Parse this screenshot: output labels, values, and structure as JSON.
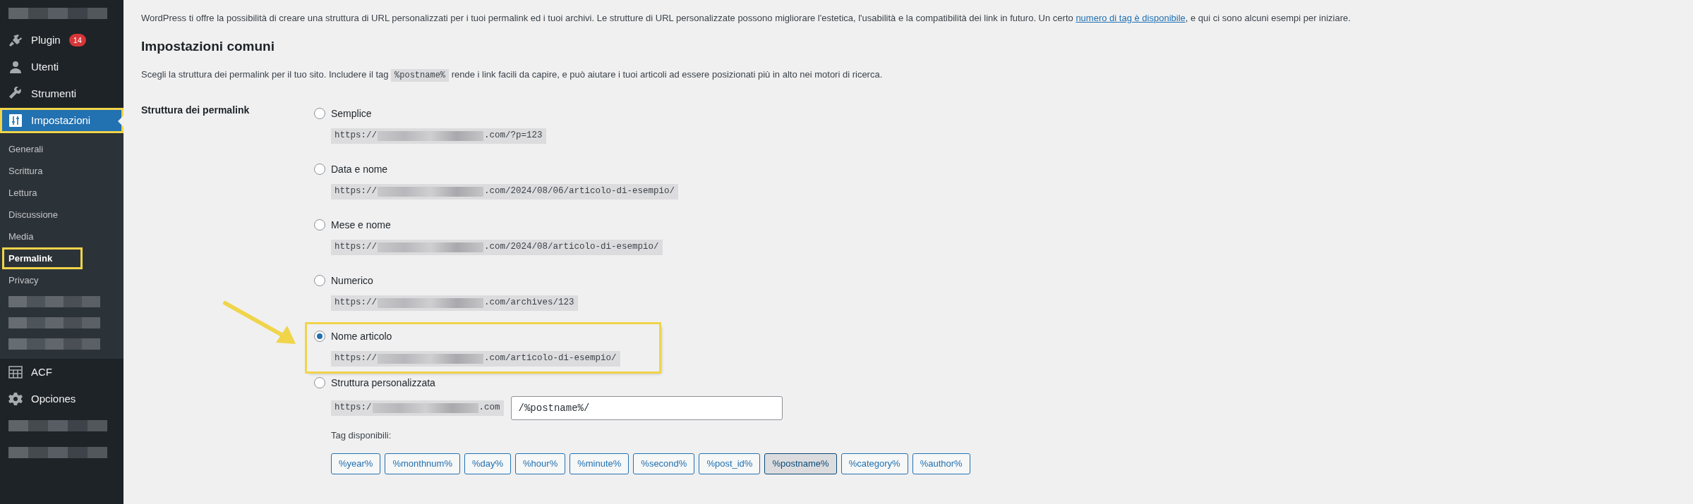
{
  "sidebar": {
    "items": [
      {
        "kind": "redacted"
      },
      {
        "kind": "item",
        "label": "Plugin",
        "badge": "14",
        "selected": false,
        "highlighted": false
      },
      {
        "kind": "item",
        "label": "Utenti",
        "selected": false,
        "highlighted": false
      },
      {
        "kind": "item",
        "label": "Strumenti",
        "selected": false,
        "highlighted": false
      },
      {
        "kind": "item",
        "label": "Impostazioni",
        "selected": true,
        "highlighted": true,
        "children": [
          {
            "kind": "item",
            "label": "Generali",
            "selected": false,
            "highlighted": false
          },
          {
            "kind": "item",
            "label": "Scrittura",
            "selected": false,
            "highlighted": false
          },
          {
            "kind": "item",
            "label": "Lettura",
            "selected": false,
            "highlighted": false
          },
          {
            "kind": "item",
            "label": "Discussione",
            "selected": false,
            "highlighted": false
          },
          {
            "kind": "item",
            "label": "Media",
            "selected": false,
            "highlighted": false
          },
          {
            "kind": "item",
            "label": "Permalink",
            "selected": true,
            "highlighted": true
          },
          {
            "kind": "item",
            "label": "Privacy",
            "selected": false,
            "highlighted": false
          },
          {
            "kind": "redacted"
          },
          {
            "kind": "redacted"
          },
          {
            "kind": "redacted"
          }
        ]
      },
      {
        "kind": "item",
        "label": "ACF",
        "selected": false,
        "highlighted": false
      },
      {
        "kind": "item",
        "label": "Opciones",
        "selected": false,
        "highlighted": false
      },
      {
        "kind": "redacted"
      },
      {
        "kind": "redacted"
      }
    ]
  },
  "intro": {
    "before": "WordPress ti offre la possibilità di creare una struttura di URL personalizzati per i tuoi permalink ed i tuoi archivi. Le strutture di URL personalizzate possono migliorare l'estetica, l'usabilità e la compatibilità dei link in futuro. Un certo",
    "link": "numero di tag è disponibile",
    "after": ", e qui ci sono alcuni esempi per iniziare."
  },
  "heading": "Impostazioni comuni",
  "description": {
    "before": "Scegli la struttura dei permalink per il tuo sito. Includere il tag",
    "code": "%postname%",
    "after": "rende i link facili da capire, e può aiutare i tuoi articoli ad essere posizionati più in alto nei motori di ricerca."
  },
  "structure_label": "Struttura dei permalink",
  "options": [
    {
      "label": "Semplice",
      "url_prefix": "https://",
      "url_suffix": ".com/?p=123",
      "selected": false,
      "highlighted": false
    },
    {
      "label": "Data e nome",
      "url_prefix": "https://",
      "url_suffix": ".com/2024/08/06/articolo-di-esempio/",
      "selected": false,
      "highlighted": false
    },
    {
      "label": "Mese e nome",
      "url_prefix": "https://",
      "url_suffix": ".com/2024/08/articolo-di-esempio/",
      "selected": false,
      "highlighted": false
    },
    {
      "label": "Numerico",
      "url_prefix": "https://",
      "url_suffix": ".com/archives/123",
      "selected": false,
      "highlighted": false
    },
    {
      "label": "Nome articolo",
      "url_prefix": "https://",
      "url_suffix": ".com/articolo-di-esempio/",
      "selected": true,
      "highlighted": true
    }
  ],
  "custom": {
    "label": "Struttura personalizzata",
    "selected": false,
    "url_prefix": "https:/",
    "url_suffix": ".com",
    "value": "/%postname%/",
    "tags_label": "Tag disponibili:",
    "tags": [
      {
        "label": "%year%",
        "selected": false
      },
      {
        "label": "%monthnum%",
        "selected": false
      },
      {
        "label": "%day%",
        "selected": false
      },
      {
        "label": "%hour%",
        "selected": false
      },
      {
        "label": "%minute%",
        "selected": false
      },
      {
        "label": "%second%",
        "selected": false
      },
      {
        "label": "%post_id%",
        "selected": false
      },
      {
        "label": "%postname%",
        "selected": true
      },
      {
        "label": "%category%",
        "selected": false
      },
      {
        "label": "%author%",
        "selected": false
      }
    ]
  }
}
